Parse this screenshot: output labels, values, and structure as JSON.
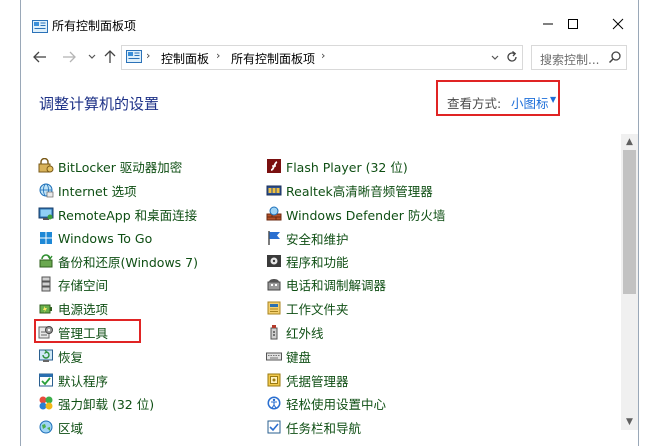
{
  "window": {
    "title": "所有控制面板项",
    "controls": {
      "minimize": "—",
      "maximize": "☐",
      "close": "✕"
    }
  },
  "address": {
    "back": "←",
    "forward": "→",
    "recent": "⌄",
    "up": "↑",
    "crumbs": [
      "控制面板",
      "所有控制面板项"
    ],
    "separator": "›",
    "dropdown": "⌄",
    "refresh": "↻"
  },
  "search": {
    "placeholder": "搜索控制..."
  },
  "page": {
    "title": "调整计算机的设置"
  },
  "view": {
    "label": "查看方式:",
    "value": "小图标",
    "caret": "▼"
  },
  "items_left": [
    {
      "label": "BitLocker 驱动器加密",
      "icon": "bitlocker-icon"
    },
    {
      "label": "Internet 选项",
      "icon": "internet-options-icon"
    },
    {
      "label": "RemoteApp 和桌面连接",
      "icon": "remoteapp-icon"
    },
    {
      "label": "Windows To Go",
      "icon": "windows-to-go-icon"
    },
    {
      "label": "备份和还原(Windows 7)",
      "icon": "backup-restore-icon"
    },
    {
      "label": "存储空间",
      "icon": "storage-spaces-icon"
    },
    {
      "label": "电源选项",
      "icon": "power-options-icon"
    },
    {
      "label": "管理工具",
      "icon": "admin-tools-icon"
    },
    {
      "label": "恢复",
      "icon": "recovery-icon"
    },
    {
      "label": "默认程序",
      "icon": "default-programs-icon"
    },
    {
      "label": "强力卸载 (32 位)",
      "icon": "power-uninstall-icon"
    },
    {
      "label": "区域",
      "icon": "region-icon"
    }
  ],
  "items_right": [
    {
      "label": "Flash Player (32 位)",
      "icon": "flash-player-icon"
    },
    {
      "label": "Realtek高清晰音频管理器",
      "icon": "realtek-audio-icon"
    },
    {
      "label": "Windows Defender 防火墙",
      "icon": "firewall-icon"
    },
    {
      "label": "安全和维护",
      "icon": "security-maintenance-icon"
    },
    {
      "label": "程序和功能",
      "icon": "programs-features-icon"
    },
    {
      "label": "电话和调制解调器",
      "icon": "phone-modem-icon"
    },
    {
      "label": "工作文件夹",
      "icon": "work-folders-icon"
    },
    {
      "label": "红外线",
      "icon": "infrared-icon"
    },
    {
      "label": "键盘",
      "icon": "keyboard-icon"
    },
    {
      "label": "凭据管理器",
      "icon": "credential-manager-icon"
    },
    {
      "label": "轻松使用设置中心",
      "icon": "ease-of-access-icon"
    },
    {
      "label": "任务栏和导航",
      "icon": "taskbar-navigation-icon"
    }
  ],
  "scrollbar": {
    "up": "▲",
    "down": "▼"
  },
  "colors": {
    "title_blue": "#1e3287",
    "link_green": "#0f4f14",
    "accent_blue": "#1e6fd9",
    "highlight_red": "#e02424"
  }
}
